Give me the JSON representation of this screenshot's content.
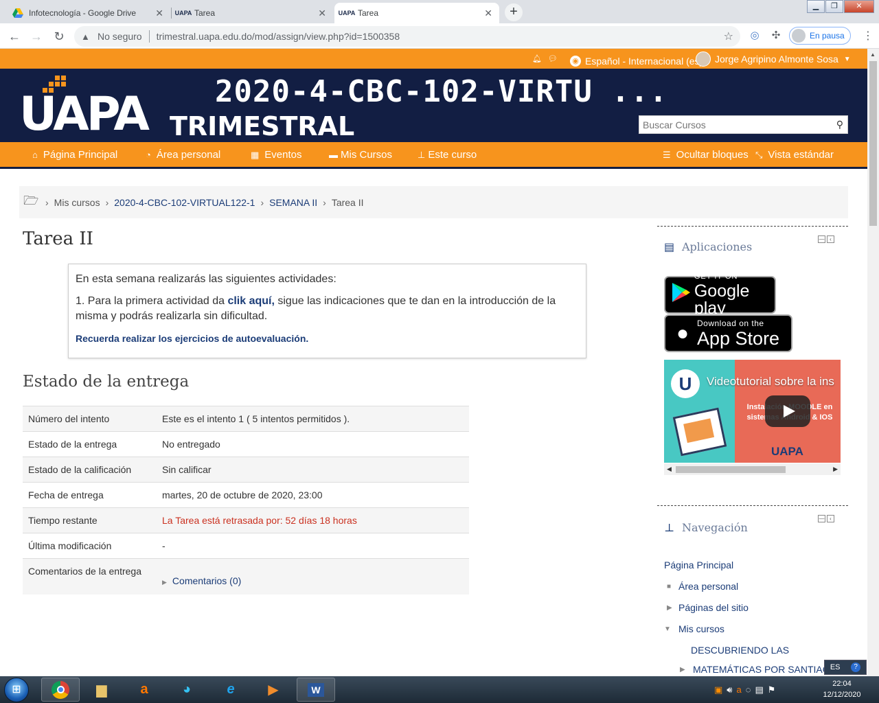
{
  "browser": {
    "tabs": [
      {
        "title": "Infotecnología - Google Drive",
        "favicon": "google-drive-icon"
      },
      {
        "title": "Tarea",
        "favicon": "uapa-icon"
      },
      {
        "title": "Tarea",
        "favicon": "uapa-icon",
        "active": true
      }
    ],
    "not_secure_label": "No seguro",
    "url": "trimestral.uapa.edu.do/mod/assign/view.php?id=1500358",
    "profile_status": "En pausa",
    "favicon_text": "UAPA"
  },
  "userbar": {
    "language": "Español - Internacional (es)",
    "user_name": "Jorge Agripino Almonte Sosa"
  },
  "header": {
    "logo_text": "UAPA",
    "course_title": "2020-4-CBC-102-VIRTU ...",
    "site_subtitle": "TRIMESTRAL",
    "search_placeholder": "Buscar Cursos"
  },
  "nav": {
    "items": [
      {
        "label": "Página Principal",
        "icon": "home-icon"
      },
      {
        "label": "Área personal",
        "icon": "dashboard-icon"
      },
      {
        "label": "Eventos",
        "icon": "calendar-icon"
      },
      {
        "label": "Mis Cursos",
        "icon": "briefcase-icon"
      },
      {
        "label": "Este curso",
        "icon": "sitemap-icon"
      }
    ],
    "hide_blocks": "Ocultar bloques",
    "standard_view": "Vista estándar"
  },
  "breadcrumb": {
    "items": [
      "Mis cursos",
      "2020-4-CBC-102-VIRTUAL122-1",
      "SEMANA II",
      "Tarea II"
    ]
  },
  "main": {
    "title": "Tarea II",
    "intro": {
      "line1": "En esta semana realizarás las siguientes actividades:",
      "line2_prefix": "1. Para la primera actividad da ",
      "line2_link": "clik aquí,",
      "line2_suffix": " sigue las indicaciones que te dan en la introducción de la misma y podrás realizarla sin dificultad.",
      "reminder": "Recuerda realizar los ejercicios de autoevaluación."
    },
    "status_title": "Estado de la entrega",
    "status_rows": [
      {
        "label": "Número del intento",
        "value": "Este es el intento 1 ( 5 intentos permitidos )."
      },
      {
        "label": "Estado de la entrega",
        "value": "No entregado"
      },
      {
        "label": "Estado de la calificación",
        "value": "Sin calificar"
      },
      {
        "label": "Fecha de entrega",
        "value": "martes, 20 de octubre de 2020, 23:00"
      },
      {
        "label": "Tiempo restante",
        "value": "La Tarea está retrasada por: 52 días 18 horas"
      },
      {
        "label": "Última modificación",
        "value": "-"
      },
      {
        "label": "Comentarios de la entrega",
        "value": "Comentarios (0)"
      }
    ]
  },
  "blocks": {
    "apps": {
      "title": "Aplicaciones",
      "google_play_small": "GET IT ON",
      "google_play_big": "Google play",
      "app_store_small": "Download on the",
      "app_store_big": "App Store",
      "video_title": "Videotutorial sobre la ins",
      "video_logo": "U",
      "video_subtitle": "Instalación MOODLE en sistemas Android & IOS",
      "video_brand": "UAPA"
    },
    "navigation": {
      "title": "Navegación",
      "items": [
        "Página Principal",
        "Área personal",
        "Páginas del sitio",
        "Mis cursos",
        "DESCUBRIENDO LAS",
        "MATEMÁTICAS POR SANTIAG"
      ]
    }
  },
  "taskbar": {
    "time": "22:04",
    "date": "12/12/2020",
    "input_lang": "ES"
  }
}
